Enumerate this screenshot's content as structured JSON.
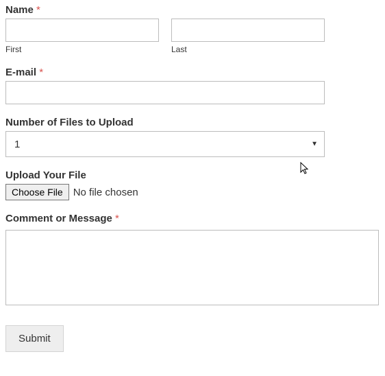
{
  "name": {
    "label": "Name",
    "required": "*",
    "first_sub": "First",
    "last_sub": "Last",
    "first_value": "",
    "last_value": ""
  },
  "email": {
    "label": "E-mail",
    "required": "*",
    "value": ""
  },
  "filecount": {
    "label": "Number of Files to Upload",
    "value": "1"
  },
  "upload": {
    "label": "Upload Your File",
    "button": "Choose File",
    "status": "No file chosen"
  },
  "comment": {
    "label": "Comment or Message",
    "required": "*",
    "value": ""
  },
  "submit": {
    "label": "Submit"
  }
}
